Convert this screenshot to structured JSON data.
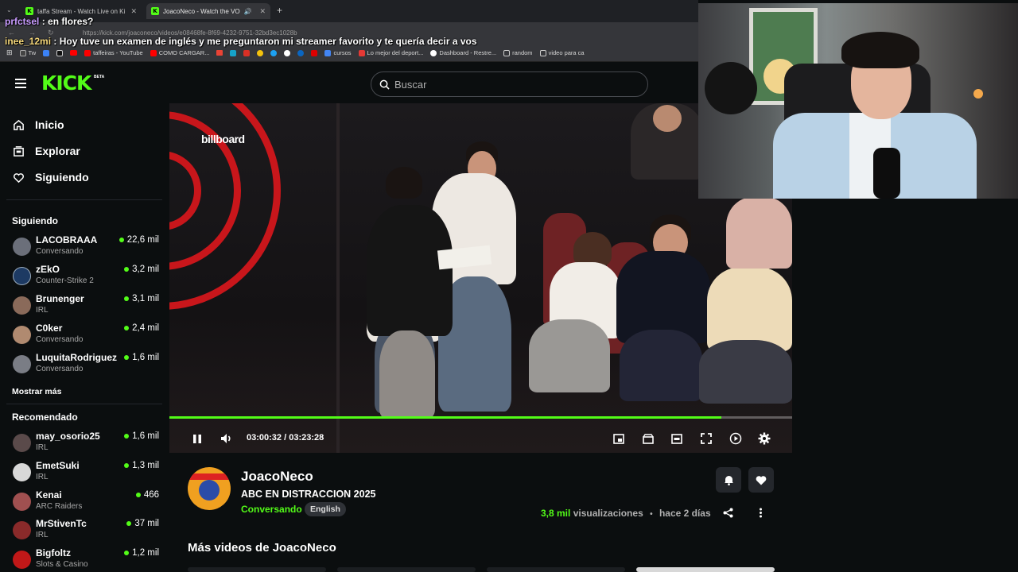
{
  "browser": {
    "tabs": [
      {
        "label": "taffa Stream - Watch Live on Ki",
        "active": false
      },
      {
        "label": "JoacoNeco - Watch the VO",
        "active": true
      }
    ],
    "url": "https://kick.com/joaconeco/videos/e08468fe-8f69-4232-9751-32bd3ec1028b",
    "bookmarks": [
      "Tw",
      "taffeiras - YouTube",
      "COMO CARGAR...",
      "cursos",
      "Lo mejor del deport...",
      "Dashboard - Restre...",
      "random",
      "video para ca"
    ]
  },
  "chat": [
    {
      "user": "prfctsel",
      "message": " : en flores?"
    },
    {
      "user": "inee_12mi",
      "message": " : Hoy tuve un examen de inglés y me preguntaron mi streamer favorito y te quería decir a vos"
    }
  ],
  "header": {
    "logo": "KICK",
    "logo_badge": "BETA",
    "search_placeholder": "Buscar"
  },
  "nav": [
    {
      "label": "Inicio",
      "icon": "home-icon"
    },
    {
      "label": "Explorar",
      "icon": "explore-icon"
    },
    {
      "label": "Siguiendo",
      "icon": "heart-icon"
    }
  ],
  "following": {
    "title": "Siguiendo",
    "channels": [
      {
        "name": "LACOBRAAA",
        "category": "Conversando",
        "viewers": "22,6 mil",
        "avatar_color": "#6b6f7a"
      },
      {
        "name": "zEkO",
        "category": "Counter-Strike 2",
        "viewers": "3,2 mil",
        "avatar_color": "#1d3a63"
      },
      {
        "name": "Brunenger",
        "category": "IRL",
        "viewers": "3,1 mil",
        "avatar_color": "#8a6a5a"
      },
      {
        "name": "C0ker",
        "category": "Conversando",
        "viewers": "2,4 mil",
        "avatar_color": "#b08a70"
      },
      {
        "name": "LuquitaRodriguez",
        "category": "Conversando",
        "viewers": "1,6 mil",
        "avatar_color": "#7a7d85"
      }
    ],
    "show_more": "Mostrar más"
  },
  "recommended": {
    "title": "Recomendado",
    "channels": [
      {
        "name": "may_osorio25",
        "category": "IRL",
        "viewers": "1,6 mil",
        "avatar_color": "#5a4a4a"
      },
      {
        "name": "EmetSuki",
        "category": "IRL",
        "viewers": "1,3 mil",
        "avatar_color": "#d8d8d8"
      },
      {
        "name": "Kenai",
        "category": "ARC Raiders",
        "viewers": "466",
        "avatar_color": "#a05050"
      },
      {
        "name": "MrStivenTc",
        "category": "IRL",
        "viewers": "37 mil",
        "avatar_color": "#8a2a2a"
      },
      {
        "name": "Bigfoltz",
        "category": "Slots & Casino",
        "viewers": "1,2 mil",
        "avatar_color": "#c01818"
      }
    ]
  },
  "player": {
    "overlay_brand": "billboard",
    "current_time": "03:00:32",
    "duration": "03:23:28",
    "progress_percent": 88.6,
    "accent": "#53fc18"
  },
  "video": {
    "streamer": "JoacoNeco",
    "title": "ABC EN DISTRACCION 2025",
    "category": "Conversando",
    "language": "English",
    "views_count": "3,8 mil",
    "views_label": " visualizaciones",
    "separator": "•",
    "age": "hace 2 días"
  },
  "more_videos_title": "Más videos de JoacoNeco"
}
